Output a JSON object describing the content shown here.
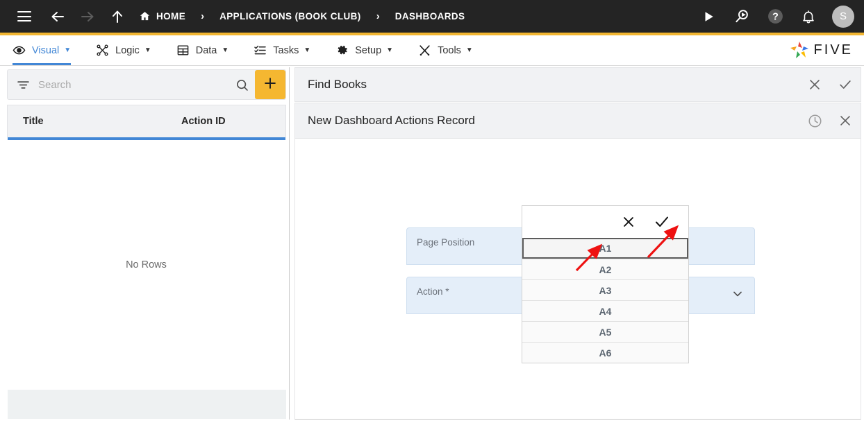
{
  "topbar": {
    "menu_icon": "hamburger-menu-icon",
    "back_icon": "arrow-left-icon",
    "forward_icon": "arrow-right-icon",
    "up_icon": "arrow-up-icon",
    "home_icon": "home-icon",
    "breadcrumbs": [
      {
        "label": "HOME"
      },
      {
        "label": "APPLICATIONS (BOOK CLUB)"
      },
      {
        "label": "DASHBOARDS"
      }
    ],
    "separator": "›",
    "actions": [
      {
        "name": "run-button",
        "icon": "play-icon"
      },
      {
        "name": "search-run-button",
        "icon": "search-play-icon"
      },
      {
        "name": "help-button",
        "icon": "help-circle-icon"
      },
      {
        "name": "notifications-button",
        "icon": "bell-icon"
      }
    ],
    "avatar_initial": "S",
    "background": "#242424",
    "accent_bar": "#f2b632"
  },
  "menubar": {
    "items": [
      {
        "label": "Visual",
        "icon": "eye-icon",
        "active": true
      },
      {
        "label": "Logic",
        "icon": "nodes-icon",
        "active": false
      },
      {
        "label": "Data",
        "icon": "grid-icon",
        "active": false
      },
      {
        "label": "Tasks",
        "icon": "checklist-icon",
        "active": false
      },
      {
        "label": "Setup",
        "icon": "gear-icon",
        "active": false
      },
      {
        "label": "Tools",
        "icon": "tools-icon",
        "active": false
      }
    ],
    "caret": "▼",
    "active_color": "#4287d6",
    "logo_text": "FIVE"
  },
  "sidebar": {
    "search": {
      "placeholder": "Search",
      "value": "",
      "filter_icon": "filter-icon",
      "search_icon": "search-icon"
    },
    "add_button": {
      "icon": "plus-icon",
      "color": "#f5b731"
    },
    "table": {
      "columns": [
        "Title",
        "Action ID"
      ],
      "rows": [],
      "empty_message": "No Rows",
      "header_underline_color": "#4287d6"
    }
  },
  "main": {
    "panel_title": "Find Books",
    "panel_actions": [
      {
        "name": "close-panel-button",
        "icon": "close-icon"
      },
      {
        "name": "confirm-panel-button",
        "icon": "check-icon"
      }
    ],
    "record_title": "New Dashboard Actions Record",
    "record_actions": [
      {
        "name": "history-button",
        "icon": "clock-icon"
      },
      {
        "name": "close-record-button",
        "icon": "close-icon"
      }
    ],
    "fields": [
      {
        "label": "Page Position",
        "value": "",
        "type": "text"
      },
      {
        "label": "Action *",
        "value": "",
        "type": "select",
        "chevron": "chevron-down-icon"
      }
    ],
    "field_background": "#e4eef9"
  },
  "dropdown": {
    "toolbar": [
      {
        "name": "dropdown-cancel-button",
        "icon": "close-icon"
      },
      {
        "name": "dropdown-confirm-button",
        "icon": "check-icon"
      }
    ],
    "options": [
      {
        "label": "A1",
        "selected": true
      },
      {
        "label": "A2",
        "selected": false
      },
      {
        "label": "A3",
        "selected": false
      },
      {
        "label": "A4",
        "selected": false
      },
      {
        "label": "A5",
        "selected": false
      },
      {
        "label": "A6",
        "selected": false
      }
    ]
  },
  "annotations": {
    "arrow_color": "#ee1111",
    "arrows": [
      {
        "name": "arrow-to-confirm-check",
        "points_at": "dropdown-confirm-button"
      },
      {
        "name": "arrow-to-option-a1",
        "points_at": "dropdown-option-a1"
      }
    ]
  }
}
